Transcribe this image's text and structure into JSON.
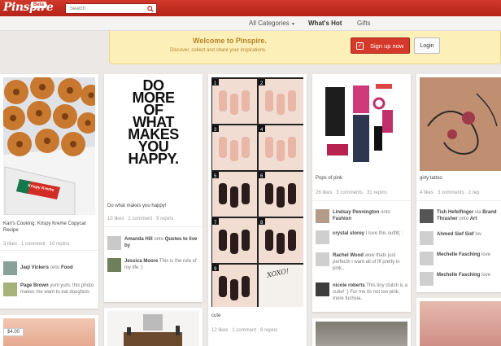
{
  "header": {
    "logo": "Pinspire",
    "beta": "Beta",
    "search_placeholder": "Search"
  },
  "nav": {
    "categories": "All Categories",
    "whats_hot": "What's Hot",
    "gifts": "Gifts"
  },
  "welcome": {
    "title": "Welcome to Pinspire.",
    "subtitle": "Discover, collect and share your inspirations.",
    "signup": "Sign up now",
    "login": "Login"
  },
  "col1": {
    "desc": "Kari's Cooking: Krispy Kreme Copycat Recipe",
    "likes": "3 likes",
    "comments": "1 comment",
    "repins": "10 repins",
    "c1_name": "Jaqi Vickers",
    "c1_onto": "onto",
    "c1_board": "Food",
    "c2_name": "Page Brown",
    "c2_text": "yum yum, this photo makes me want to eat doughuts",
    "price": "$4.00",
    "box_text": "Krispy Kreme"
  },
  "col2": {
    "quote": [
      "DO",
      "MORE",
      "OF",
      "WHAT",
      "MAKES",
      "YOU",
      "HAPPY."
    ],
    "desc": "Do what makes you happy!",
    "likes": "10 likes",
    "comments": "1 comment",
    "repins": "9 repins",
    "c1_name": "Amanda Hill",
    "c1_onto": "onto",
    "c1_board": "Quotes to live by",
    "c2_name": "Jessica Moore",
    "c2_text": "This is the rule of my life :)"
  },
  "col3": {
    "steps": [
      "1",
      "2",
      "3",
      "4",
      "5",
      "6",
      "7",
      "8",
      "9"
    ],
    "xoxo": "XOXO!",
    "desc": "cute",
    "likes": "12 likes",
    "comments": "1 comment",
    "repins": "8 repins"
  },
  "col4": {
    "desc": "Pops of pink",
    "likes": "26 likes",
    "comments": "3 comments",
    "repins": "31 repins",
    "c1_name": "Lindsay Pennington",
    "c1_onto": "onto",
    "c1_board": "Fashion",
    "c2_name": "crystal storey",
    "c2_text": "I love this outfit( :",
    "c3_name": "Rachel Wood",
    "c3_text": "wow thats just perfecth i want all of iff pretty in pink..",
    "c4_name": "nicole roberts",
    "c4_text": "This tiny clutch is a cutie! :) For me its not too pink, more fuchsia."
  },
  "col5": {
    "desc": "girly tattoo",
    "likes": "4 likes",
    "comments": "3 comments",
    "repins": "2 rep",
    "c1_name": "Tish Hefelfinger",
    "c1_via": "via",
    "c1_name2": "Brand Thrasher",
    "c1_onto": "onto",
    "c1_board": "Art",
    "c2_name": "Ahmed Sief Sief",
    "c2_text": "lov",
    "c3_name": "Mechelle Fasching",
    "c3_text": "love",
    "c4_name": "Mechelle Fasching",
    "c4_text": "love"
  },
  "colors": {
    "brand": "#c0392b",
    "accent": "#d5392a",
    "banner": "#fcefb7",
    "link": "#444444"
  }
}
